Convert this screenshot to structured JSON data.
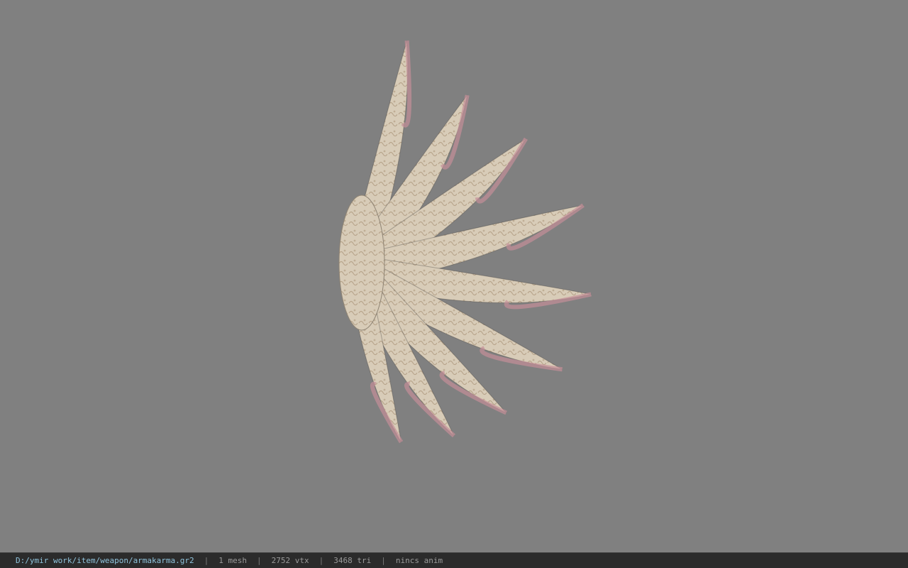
{
  "viewport": {
    "background": "#808080",
    "model": {
      "icon": "winged-blade-model",
      "base_color": "#d8ccb8",
      "edge_color": "#c48f98"
    }
  },
  "statusbar": {
    "file_path": "D:/ymir work/item/weapon/armakarma.gr2",
    "separator": "|",
    "mesh_count": "1 mesh",
    "vertex_count": "2752 vtx",
    "triangle_count": "3468 tri",
    "anim_status": "nincs anim"
  }
}
